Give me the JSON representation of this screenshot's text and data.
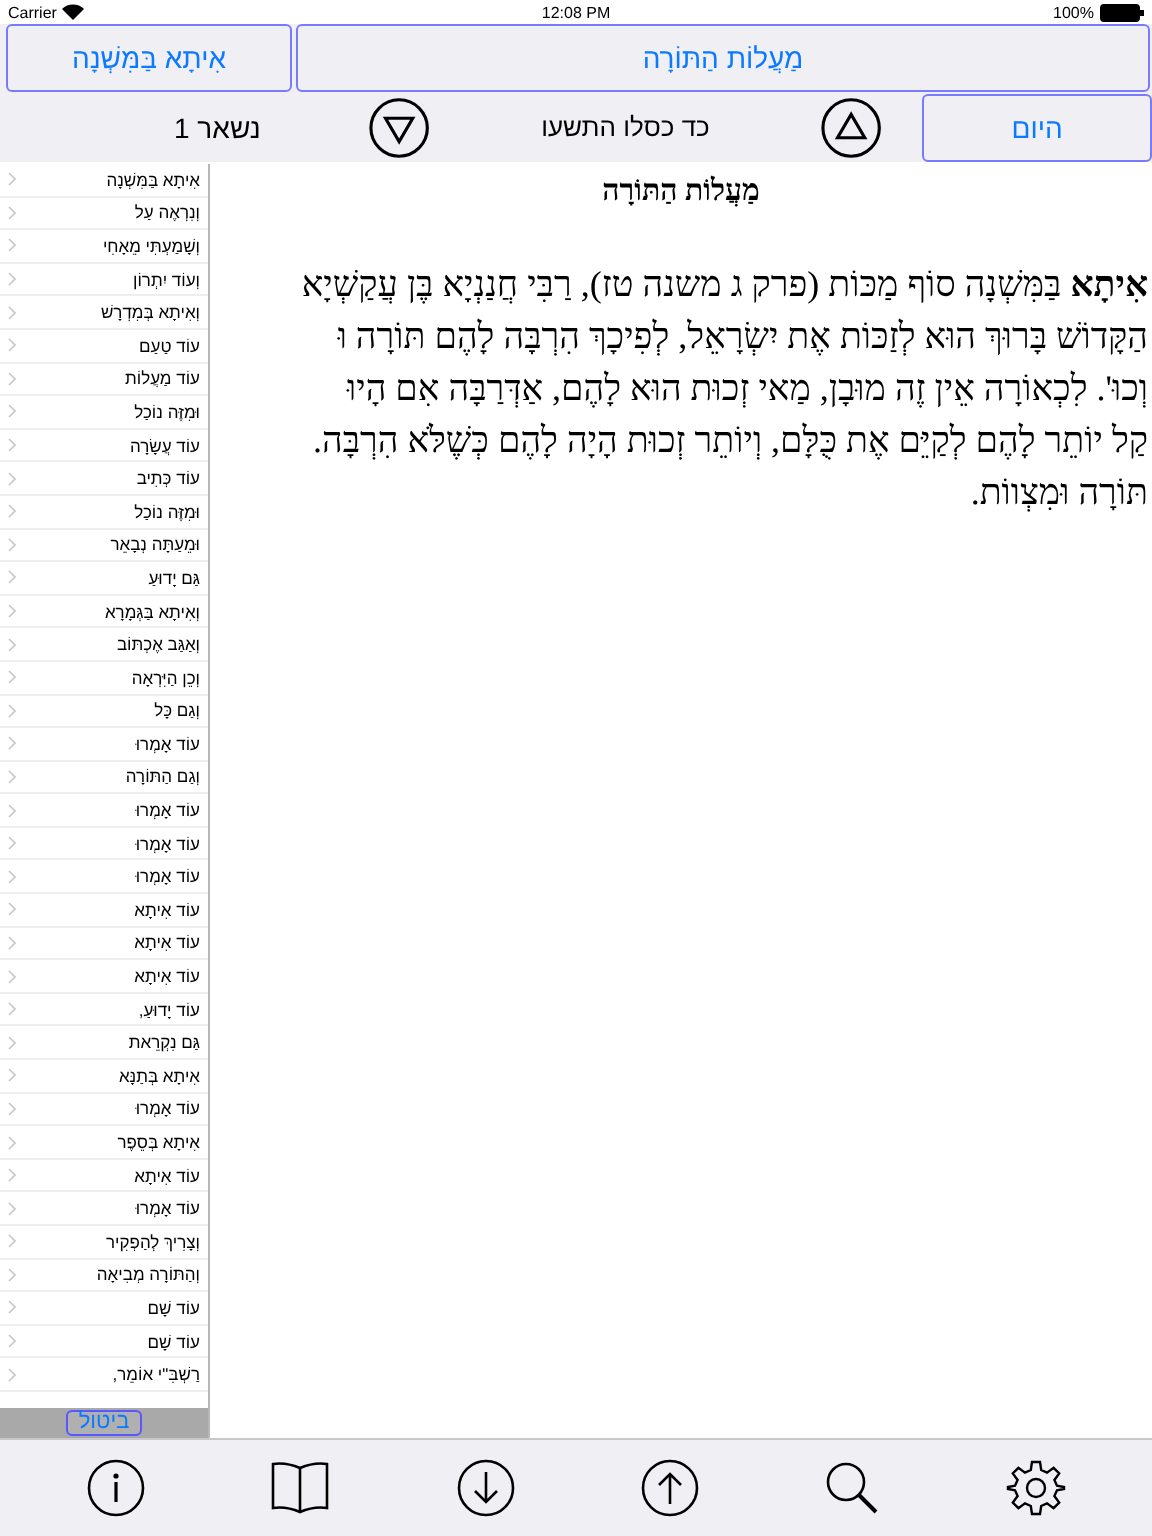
{
  "status_bar": {
    "carrier": "Carrier",
    "time": "12:08 PM",
    "battery": "100%"
  },
  "header": {
    "section_button": "אִיתָא בַּמִּשְׁנָה",
    "title_button": "מַעֲלוֹת הַתּוֹרָה"
  },
  "date_bar": {
    "today_button": "היום",
    "date": "כד כסלו התשעו",
    "remaining": "נשאר 1"
  },
  "sidebar": {
    "items": [
      "אִיתָא בַּמִּשְׁנָה",
      "וְנִרְאֶה עַל",
      "וְשָׁמַעְתִּי מֵאָחִי",
      "וְעוֹד יִתְרוֹן",
      "וְאִיתָא בְּמִדְרָשׁ",
      "עוֹד טַעַם",
      "עוֹד מַעֲלוֹת",
      "וּמִזֶּה נוֹכַל",
      "עוֹד עֲשָׂרָה",
      "עוֹד כְּתִיב",
      "וּמִזֶּה נוֹכַל",
      "וּמֵעַתָּה נְבָאֵר",
      "גַּם יָדוּעַ",
      "וְאִיתָא בַּגְּמָרָא",
      "וְאַגַּב אֶכְתּוֹב",
      "וְכֵן הַיִּרְאָה",
      "וְגַם כָּל",
      "עוֹד אָמְרוּ",
      "וְגַם הַתּוֹרָה",
      "עוֹד אָמְרוּ",
      "עוֹד אָמְרוּ",
      "עוֹד אָמְרוּ",
      "עוֹד אִיתָא",
      "עוֹד אִיתָא",
      "עוֹד אִיתָא",
      "עוֹד יָדוּעַ,",
      "גַּם נִקְרֵאת",
      "אִיתָא בְּתַנָּא",
      "עוֹד אָמְרוּ",
      "אִיתָא בְּסֵפֶר",
      "עוֹד אִיתָא",
      "עוֹד אָמְרוּ",
      "וְצָרִיךְ לְהַפְקִיר",
      "וְהַתּוֹרָה מְבִיאָה",
      "עוֹד שָׁם",
      "עוֹד שָׁם",
      "רַשְׁבִּ\"י אוֹמֵר,"
    ],
    "cancel_button": "ביטול"
  },
  "article": {
    "title": "מַעֲלוֹת הַתּוֹרָה",
    "lines": [
      "**אִיתָא** בַּמִּשְׁנָה סוֹף מַכּוֹת (פרק ג משנה טז), רַבִּי חֲנַנְיָא בֶּן עֲקַשְׁיָא",
      "הַקָּדוֹשׁ בָּרוּךְ הוּא לְזַכּוֹת אֶת יִשְׂרָאֵל, לְפִיכָךְ הִרְבָּה לָהֶם תּוֹרָה וּ",
      "וְכוּ'. לִכְאוֹרָה אֵין זֶה מוּבָן, מַאי זְכוּת הוּא לָהֶם, אַדְּרַבָּה אִם הָיוּ",
      "קַל יוֹתֵר לָהֶם לְקַיֵּם אֶת כֻּלָּם, וְיוֹתֵר זְכוּת הָיָה לָהֶם כְּשֶׁלֹּא הִרְבָּה.",
      "תּוֹרָה וּמִצְווֹת."
    ]
  }
}
